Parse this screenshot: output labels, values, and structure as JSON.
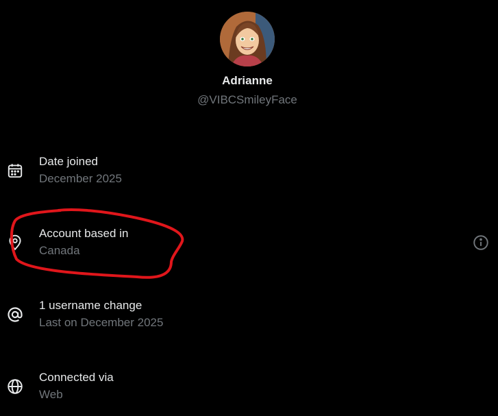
{
  "profile": {
    "display_name": "Adrianne",
    "handle": "@VIBCSmileyFace"
  },
  "rows": [
    {
      "title": "Date joined",
      "subtitle": "December 2025",
      "icon": "calendar-icon"
    },
    {
      "title": "Account based in",
      "subtitle": "Canada",
      "icon": "location-pin-icon",
      "has_info": true
    },
    {
      "title": "1 username change",
      "subtitle": "Last on December 2025",
      "icon": "at-sign-icon"
    },
    {
      "title": "Connected via",
      "subtitle": "Web",
      "icon": "globe-icon"
    }
  ],
  "colors": {
    "background": "#000000",
    "primary_text": "#e7e9ea",
    "secondary_text": "#71767b",
    "annotation": "#e0161b"
  }
}
